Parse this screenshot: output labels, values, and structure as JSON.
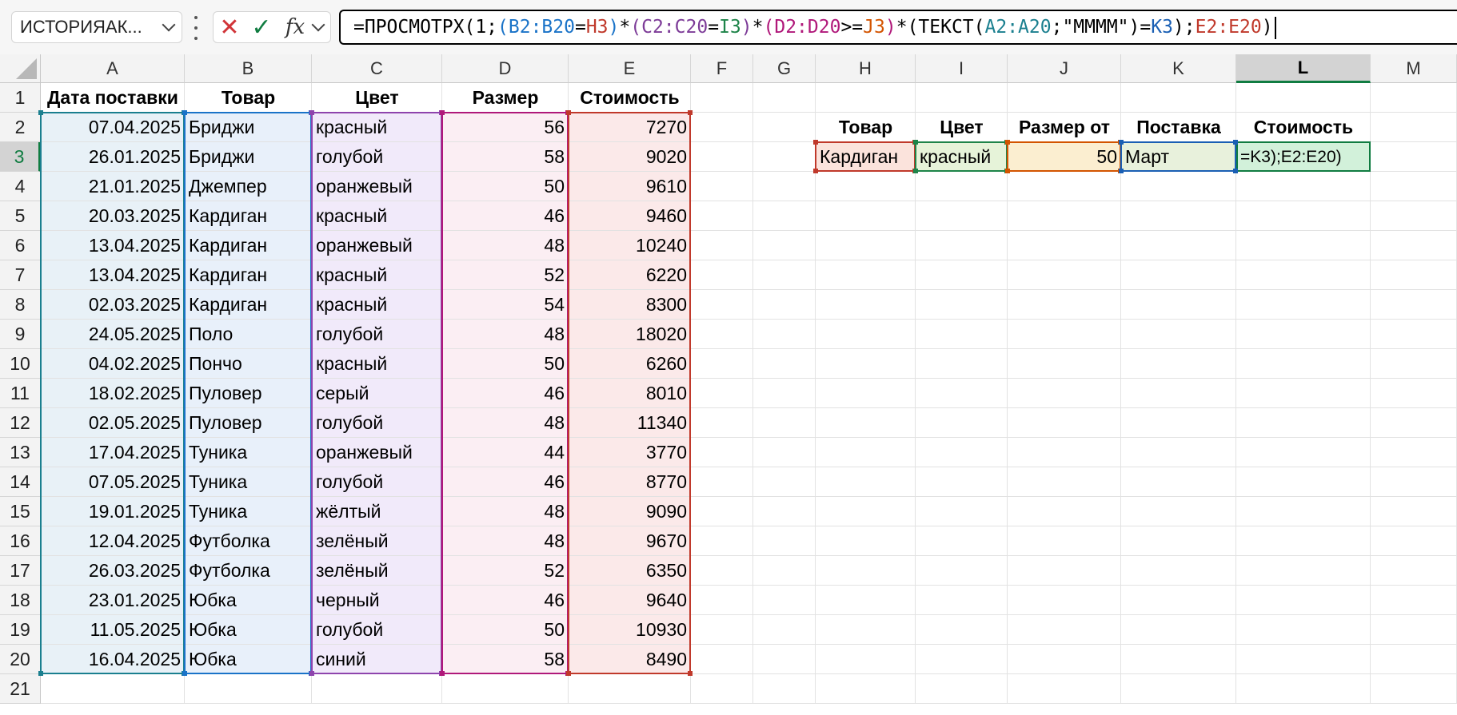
{
  "name_box": {
    "value": "ИСТОРИЯАК..."
  },
  "formula_bar": {
    "fx_label": "fx",
    "segments": [
      {
        "text": "=ПРОСМОТРХ(1;",
        "color": "#000000"
      },
      {
        "text": "(",
        "color": "#1a73c8"
      },
      {
        "text": "B2:B20",
        "color": "#1a73c8"
      },
      {
        "text": "=",
        "color": "#000000"
      },
      {
        "text": "H3",
        "color": "#c0392b"
      },
      {
        "text": ")",
        "color": "#1a73c8"
      },
      {
        "text": "*",
        "color": "#000000"
      },
      {
        "text": "(",
        "color": "#7d3c98"
      },
      {
        "text": "C2:C20",
        "color": "#7d3c98"
      },
      {
        "text": "=",
        "color": "#000000"
      },
      {
        "text": "I3",
        "color": "#1e8449"
      },
      {
        "text": ")",
        "color": "#7d3c98"
      },
      {
        "text": "*",
        "color": "#000000"
      },
      {
        "text": "(",
        "color": "#b0187a"
      },
      {
        "text": "D2:D20",
        "color": "#b0187a"
      },
      {
        "text": ">=",
        "color": "#000000"
      },
      {
        "text": "J3",
        "color": "#d35400"
      },
      {
        "text": ")",
        "color": "#b0187a"
      },
      {
        "text": "*",
        "color": "#000000"
      },
      {
        "text": "(ТЕКСТ(",
        "color": "#000000"
      },
      {
        "text": "A2:A20",
        "color": "#1a7f8f"
      },
      {
        "text": ";\"ММММ\")=",
        "color": "#000000"
      },
      {
        "text": "K3",
        "color": "#1a5fb4"
      },
      {
        "text": ");",
        "color": "#000000"
      },
      {
        "text": "E2:E20",
        "color": "#c0392b"
      },
      {
        "text": ")",
        "color": "#000000"
      }
    ]
  },
  "columns": [
    "A",
    "B",
    "C",
    "D",
    "E",
    "F",
    "G",
    "H",
    "I",
    "J",
    "K",
    "L",
    "M"
  ],
  "selected_column": "L",
  "rows": [
    "1",
    "2",
    "3",
    "4",
    "5",
    "6",
    "7",
    "8",
    "9",
    "10",
    "11",
    "12",
    "13",
    "14",
    "15",
    "16",
    "17",
    "18",
    "19",
    "20",
    "21"
  ],
  "selected_row": "3",
  "table": {
    "headers": [
      "Дата поставки",
      "Товар",
      "Цвет",
      "Размер",
      "Стоимость"
    ],
    "rows": [
      [
        "07.04.2025",
        "Бриджи",
        "красный",
        "56",
        "7270"
      ],
      [
        "26.01.2025",
        "Бриджи",
        "голубой",
        "58",
        "9020"
      ],
      [
        "21.01.2025",
        "Джемпер",
        "оранжевый",
        "50",
        "9610"
      ],
      [
        "20.03.2025",
        "Кардиган",
        "красный",
        "46",
        "9460"
      ],
      [
        "13.04.2025",
        "Кардиган",
        "оранжевый",
        "48",
        "10240"
      ],
      [
        "13.04.2025",
        "Кардиган",
        "красный",
        "52",
        "6220"
      ],
      [
        "02.03.2025",
        "Кардиган",
        "красный",
        "54",
        "8300"
      ],
      [
        "24.05.2025",
        "Поло",
        "голубой",
        "48",
        "18020"
      ],
      [
        "04.02.2025",
        "Пончо",
        "красный",
        "50",
        "6260"
      ],
      [
        "18.02.2025",
        "Пуловер",
        "серый",
        "46",
        "8010"
      ],
      [
        "02.05.2025",
        "Пуловер",
        "голубой",
        "48",
        "11340"
      ],
      [
        "17.04.2025",
        "Туника",
        "оранжевый",
        "44",
        "3770"
      ],
      [
        "07.05.2025",
        "Туника",
        "голубой",
        "46",
        "8770"
      ],
      [
        "19.01.2025",
        "Туника",
        "жёлтый",
        "48",
        "9090"
      ],
      [
        "12.04.2025",
        "Футболка",
        "зелёный",
        "48",
        "9670"
      ],
      [
        "26.03.2025",
        "Футболка",
        "зелёный",
        "52",
        "6350"
      ],
      [
        "23.01.2025",
        "Юбка",
        "черный",
        "46",
        "9640"
      ],
      [
        "11.05.2025",
        "Юбка",
        "голубой",
        "50",
        "10930"
      ],
      [
        "16.04.2025",
        "Юбка",
        "синий",
        "58",
        "8490"
      ]
    ]
  },
  "criteria": {
    "headers": [
      "Товар",
      "Цвет",
      "Размер от",
      "Поставка",
      "Стоимость"
    ],
    "values": [
      "Кардиган",
      "красный",
      "50",
      "Март",
      "=K3);E2:E20)"
    ]
  },
  "colors": {
    "ref_blue": "#1a73c8",
    "ref_purple": "#8e44ad",
    "ref_magenta": "#b0187a",
    "ref_red": "#c0392b",
    "ref_teal": "#1a7f8f",
    "ref_green": "#1e8449",
    "ref_orange": "#d35400",
    "ref_darkblue": "#1a5fb4",
    "excel_green": "#107c41"
  }
}
